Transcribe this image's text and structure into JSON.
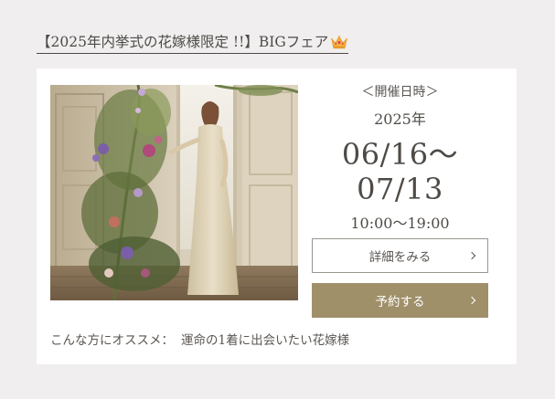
{
  "event": {
    "title": "【2025年内挙式の花嫁様限定 !!】BIGフェア",
    "title_icon": "crown-icon"
  },
  "schedule": {
    "label": "＜開催日時＞",
    "year": "2025年",
    "dates_line1": "06/16～",
    "dates_line2": "07/13",
    "time": "10:00～19:00"
  },
  "buttons": {
    "detail_label": "詳細をみる",
    "reserve_label": "予約する"
  },
  "recommend": {
    "label": "こんな方にオススメ：",
    "value": "運命の1着に出会いたい花嫁様"
  },
  "colors": {
    "page_background": "#f0eeef",
    "card_background": "#ffffff",
    "accent": "#a0906a",
    "text": "#4e4a46"
  }
}
